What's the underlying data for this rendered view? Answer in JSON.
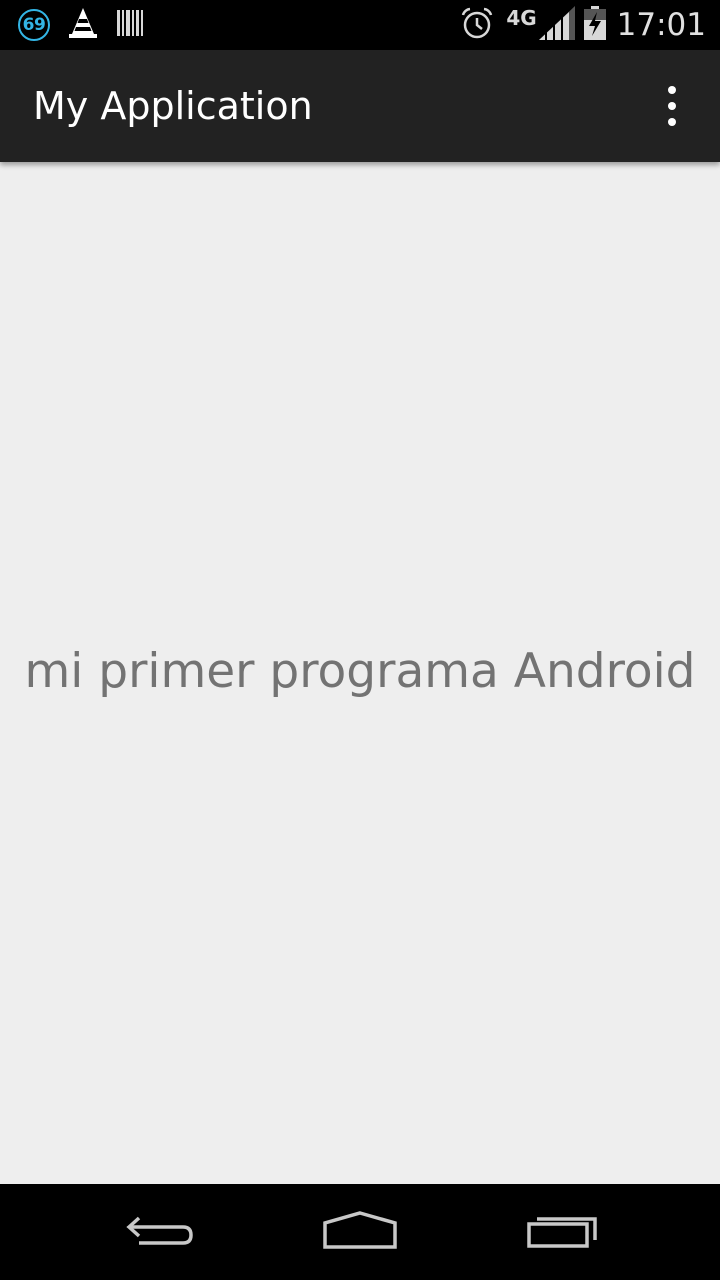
{
  "status_bar": {
    "notification_count": "69",
    "network_type": "4G",
    "time": "17:01",
    "icons": [
      "notification-count-icon",
      "vlc-cone-icon",
      "barcode-icon",
      "alarm-icon",
      "signal-icon",
      "battery-charging-icon"
    ]
  },
  "action_bar": {
    "title": "My Application",
    "menu_icon": "overflow-menu-icon"
  },
  "content": {
    "text": "mi primer programa Android"
  },
  "nav_bar": {
    "icons": [
      "back-icon",
      "home-icon",
      "recent-apps-icon"
    ]
  },
  "colors": {
    "status_bar": "#000000",
    "action_bar": "#222222",
    "background": "#eeeeee",
    "text": "#737373",
    "accent": "#33b5e5"
  }
}
